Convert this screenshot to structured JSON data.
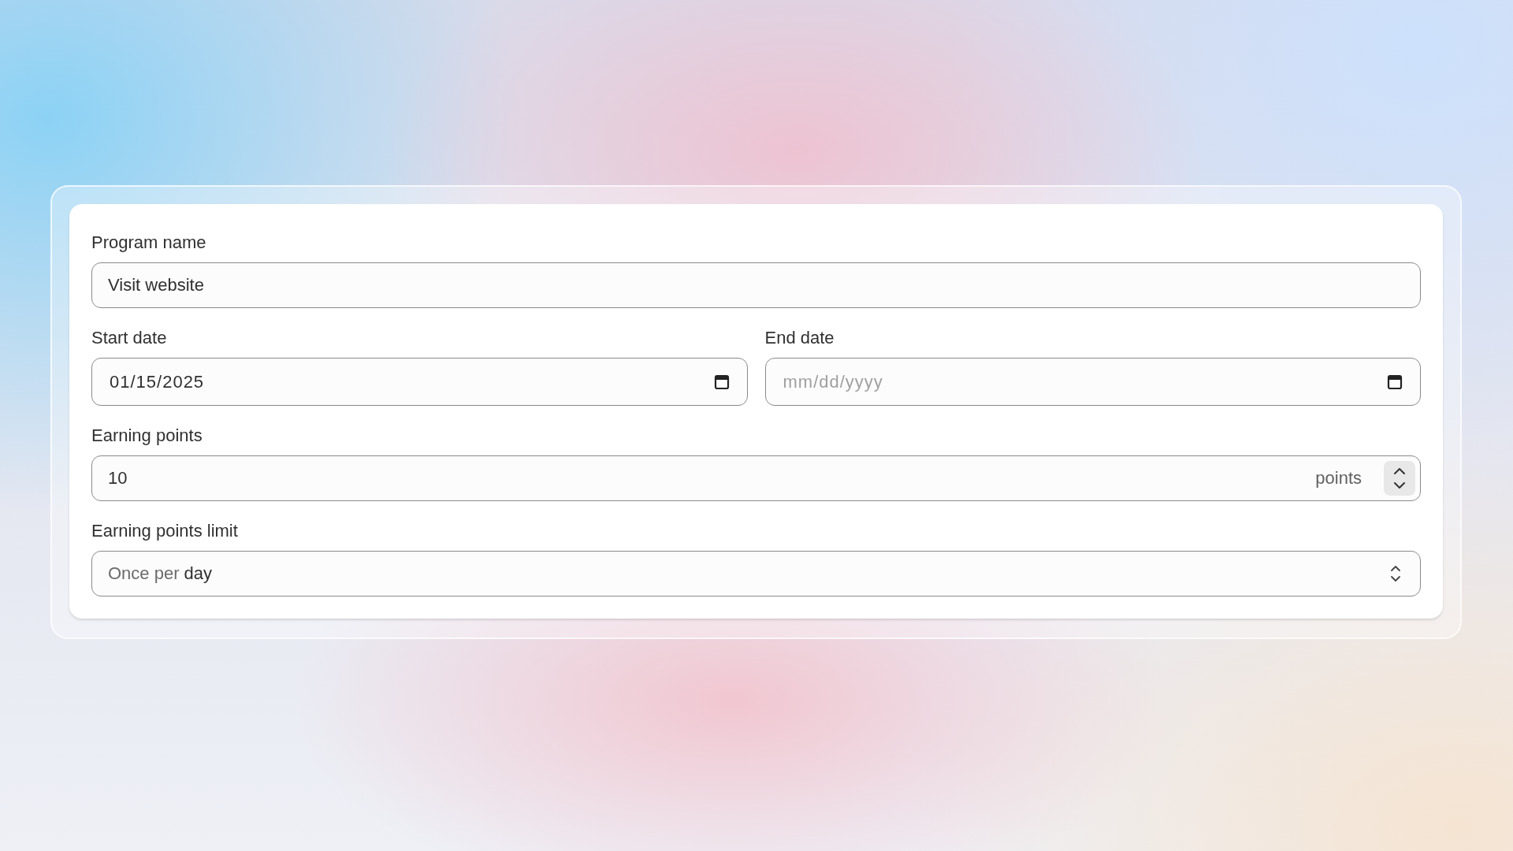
{
  "form": {
    "program_name": {
      "label": "Program name",
      "value": "Visit website"
    },
    "start_date": {
      "label": "Start date",
      "value": "01/15/2025"
    },
    "end_date": {
      "label": "End date",
      "placeholder": "mm/dd/yyyy"
    },
    "earning_points": {
      "label": "Earning points",
      "value": "10",
      "suffix": "points"
    },
    "earning_points_limit": {
      "label": "Earning points limit",
      "prefix": "Once per",
      "value": "day"
    }
  }
}
